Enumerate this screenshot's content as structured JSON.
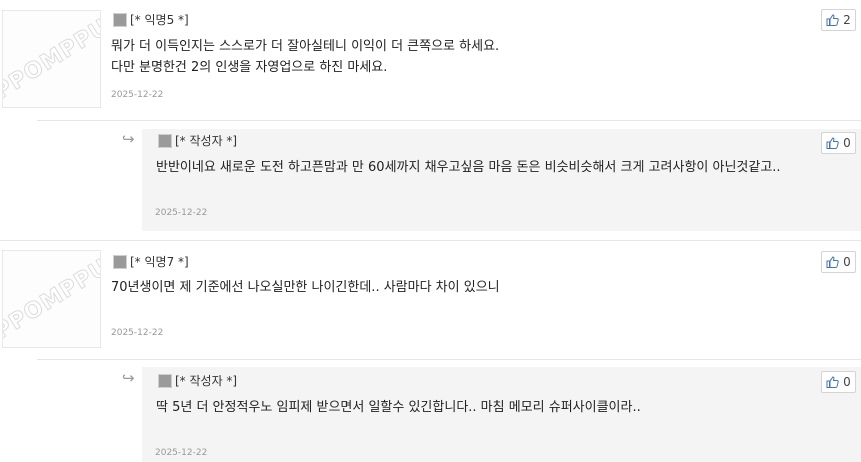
{
  "comments": [
    {
      "author": "[* 익명5 *]",
      "lines": [
        "뭐가 더 이득인지는 스스로가 더 잘아실테니 이익이 더 큰쪽으로 하세요.",
        "다만 분명한건 2의 인생을 자영업으로 하진 마세요."
      ],
      "date": "2025-12-22",
      "likes": "2",
      "avatar_text": "PPOMPPU"
    },
    {
      "author": "[* 작성자 *]",
      "lines": [
        "반반이네요 새로운 도전 하고픈맘과 만 60세까지 채우고싶음 마음 돈은 비슷비슷해서 크게 고려사항이 아닌것같고.."
      ],
      "date": "2025-12-22",
      "likes": "0",
      "reply_arrow": "↪"
    },
    {
      "author": "[* 익명7 *]",
      "lines": [
        "70년생이면  제 기준에선 나오실만한 나이긴한데.. 사람마다 차이 있으니"
      ],
      "date": "2025-12-22",
      "likes": "0",
      "avatar_text": "PPOMPPU"
    },
    {
      "author": "[* 작성자 *]",
      "lines": [
        "딱 5년 더 안정적우노 임피제 받으면서 일할수 있긴합니다.. 마침 메모리 슈퍼사이클이라.."
      ],
      "date": "2025-12-22",
      "likes": "0",
      "reply_arrow": "↪"
    }
  ],
  "colors": {
    "reply_bg": "#f4f4f4",
    "date": "#999999",
    "like_icon": "#3b73c8"
  },
  "icons": {
    "like": "thumbs-up-icon",
    "author_badge": "gray-square-icon",
    "reply": "reply-arrow-icon"
  }
}
